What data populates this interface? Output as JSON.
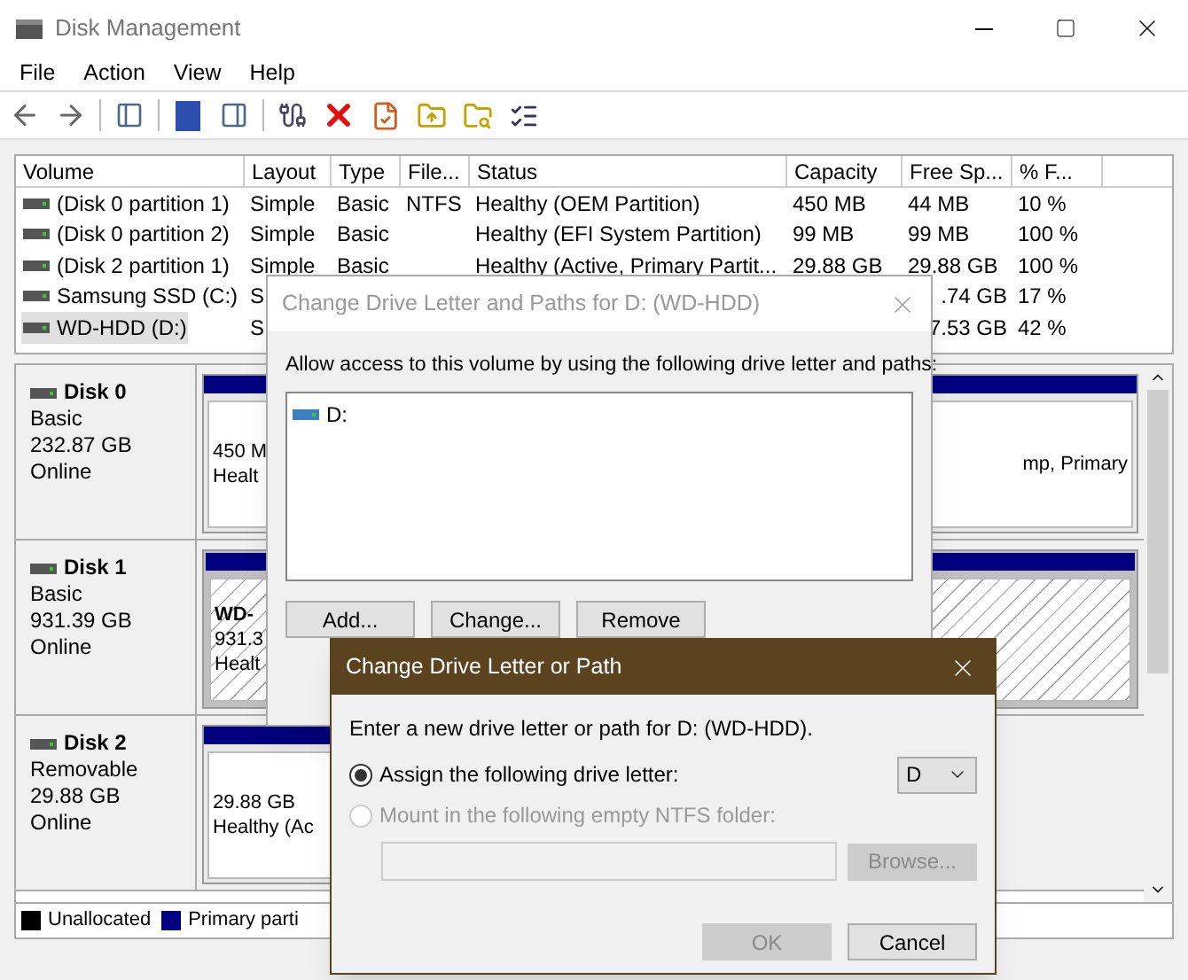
{
  "window": {
    "title": "Disk Management"
  },
  "menu": [
    "File",
    "Action",
    "View",
    "Help"
  ],
  "volumes": {
    "columns": [
      "Volume",
      "Layout",
      "Type",
      "File...",
      "Status",
      "Capacity",
      "Free Sp...",
      "% F..."
    ],
    "rows": [
      {
        "volume": "(Disk 0 partition 1)",
        "layout": "Simple",
        "type": "Basic",
        "file_system": "NTFS",
        "status": "Healthy (OEM Partition)",
        "capacity": "450 MB",
        "free_space": "44 MB",
        "percent_free": "10 %",
        "selected": false
      },
      {
        "volume": "(Disk 0 partition 2)",
        "layout": "Simple",
        "type": "Basic",
        "status": "Healthy (EFI System Partition)",
        "capacity": "99 MB",
        "free_space": "99 MB",
        "percent_free": "100 %",
        "selected": false
      },
      {
        "volume": "(Disk 2 partition 1)",
        "layout": "Simple",
        "type": "Basic",
        "status": "Healthy (Active, Primary Partit...",
        "capacity": "29.88 GB",
        "free_space": "29.88 GB",
        "percent_free": "100 %",
        "selected": false
      },
      {
        "volume": "Samsung SSD (C:)",
        "layout": "S",
        "free_space": ".74 GB",
        "percent_free": "17 %",
        "selected": false
      },
      {
        "volume": "WD-HDD (D:)",
        "layout": "S",
        "free_space": "7.53 GB",
        "percent_free": "42 %",
        "selected": true
      }
    ]
  },
  "disks": [
    {
      "name": "Disk 0",
      "type": "Basic",
      "size": "232.87 GB",
      "status": "Online",
      "partitions": [
        {
          "lines": [
            "450 M",
            "Healt"
          ],
          "selected": false
        },
        {
          "lines": [
            "mp, Primary"
          ],
          "selected": false
        }
      ]
    },
    {
      "name": "Disk 1",
      "type": "Basic",
      "size": "931.39 GB",
      "status": "Online",
      "partitions": [
        {
          "lines": [
            "WD-",
            "931.3",
            "Healt"
          ],
          "selected": true
        }
      ]
    },
    {
      "name": "Disk 2",
      "type": "Removable",
      "size": "29.88 GB",
      "status": "Online",
      "partitions": [
        {
          "lines": [
            "29.88 GB",
            "Healthy (Ac"
          ],
          "selected": false
        }
      ]
    }
  ],
  "legend": [
    {
      "label": "Unallocated",
      "color": "#000000"
    },
    {
      "label": "Primary parti",
      "color": "#000080"
    }
  ],
  "paths_dialog": {
    "title": "Change Drive Letter and Paths for D: (WD-HDD)",
    "instruction": "Allow access to this volume by using the following drive letter and paths:",
    "paths": [
      "D:"
    ],
    "buttons": [
      "Add...",
      "Change...",
      "Remove"
    ]
  },
  "change_dialog": {
    "title": "Change Drive Letter or Path",
    "instruction": "Enter a new drive letter or path for D: (WD-HDD).",
    "options": [
      {
        "label": "Assign the following drive letter:",
        "selected": true,
        "disabled": false
      },
      {
        "label": "Mount in the following empty NTFS folder:",
        "selected": false,
        "disabled": true
      }
    ],
    "drive_letter": "D",
    "folder_field": {
      "disabled": true
    },
    "browse": {
      "label": "Browse...",
      "disabled": true
    },
    "buttons": [
      {
        "label": "OK",
        "disabled": true
      },
      {
        "label": "Cancel",
        "disabled": false
      }
    ]
  }
}
